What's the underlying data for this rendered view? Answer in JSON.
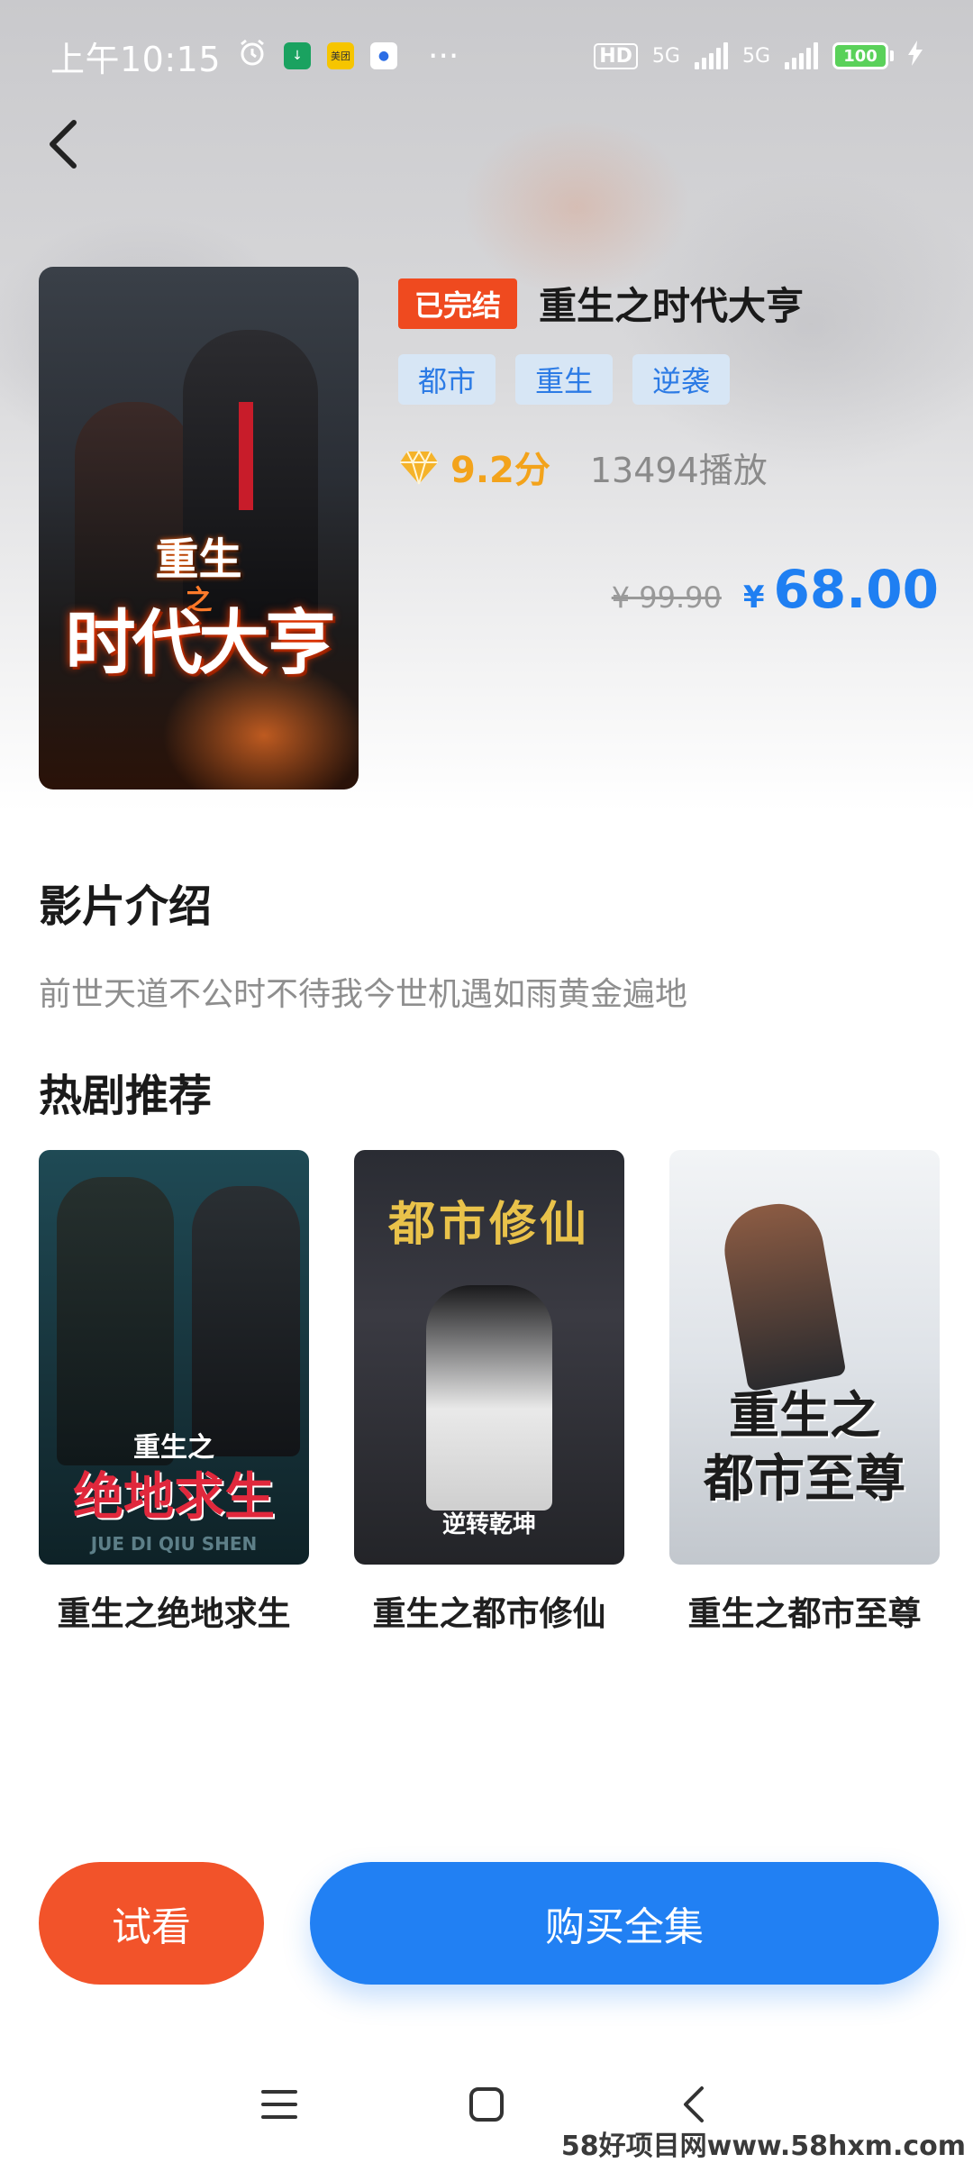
{
  "status_bar": {
    "time": "上午10:15",
    "more": "···",
    "hd": "HD",
    "net1": "5G",
    "net2": "5G",
    "battery": "100"
  },
  "movie": {
    "status_tag": "已完结",
    "title": "重生之时代大亨",
    "genres": [
      "都市",
      "重生",
      "逆袭"
    ],
    "score": "9.2分",
    "plays": "13494播放",
    "price_original": "¥ 99.90",
    "price_currency": "¥",
    "price_current": "68.00",
    "poster_text_top": "重生",
    "poster_text_zhi": "之",
    "poster_text_main": "时代大亨"
  },
  "intro": {
    "heading": "影片介绍",
    "text": "前世天道不公时不待我今世机遇如雨黄金遍地"
  },
  "recommend": {
    "heading": "热剧推荐",
    "items": [
      {
        "title": "重生之绝地求生",
        "cover_text": "重生之",
        "cover_text2": "绝地求生",
        "cover_text3": "JUE DI QIU SHEN"
      },
      {
        "title": "重生之都市修仙",
        "cover_text": "都市修仙",
        "cover_text2": "逆转乾坤"
      },
      {
        "title": "重生之都市至尊",
        "cover_text": "重生之",
        "cover_text2": "都市至尊"
      }
    ]
  },
  "actions": {
    "trial": "试看",
    "buy": "购买全集"
  },
  "colors": {
    "accent_blue": "#2180f3",
    "accent_orange": "#f2532a",
    "score_gold": "#f3a31b"
  },
  "watermark": "58好项目网www.58hxm.com"
}
